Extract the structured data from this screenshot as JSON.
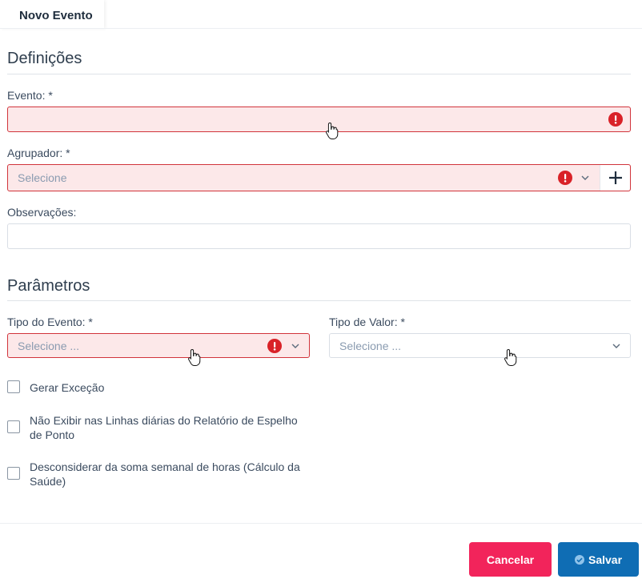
{
  "tab": {
    "label": "Novo Evento"
  },
  "sections": {
    "definicoes": "Definições",
    "parametros": "Parâmetros"
  },
  "fields": {
    "evento": {
      "label": "Evento: *",
      "value": ""
    },
    "agrupador": {
      "label": "Agrupador: *",
      "placeholder": "Selecione"
    },
    "observacoes": {
      "label": "Observações:",
      "value": ""
    },
    "tipo_evento": {
      "label": "Tipo do Evento: *",
      "placeholder": "Selecione ..."
    },
    "tipo_valor": {
      "label": "Tipo de Valor: *",
      "placeholder": "Selecione ..."
    }
  },
  "checkboxes": [
    {
      "label": "Gerar Exceção",
      "checked": false
    },
    {
      "label": "Não Exibir nas Linhas diárias do Relatório de Espelho de Ponto",
      "checked": false
    },
    {
      "label": "Desconsiderar da soma semanal de horas (Cálculo da Saúde)",
      "checked": false
    }
  ],
  "buttons": {
    "cancel": "Cancelar",
    "save": "Salvar"
  },
  "colors": {
    "error": "#d92228",
    "error_bg": "#fce8e9",
    "cancel": "#f2245b",
    "save": "#0f6db4"
  },
  "icons": [
    "error-icon",
    "chevron-down-icon",
    "plus-icon",
    "check-circle-icon",
    "hand-cursor-icon"
  ]
}
